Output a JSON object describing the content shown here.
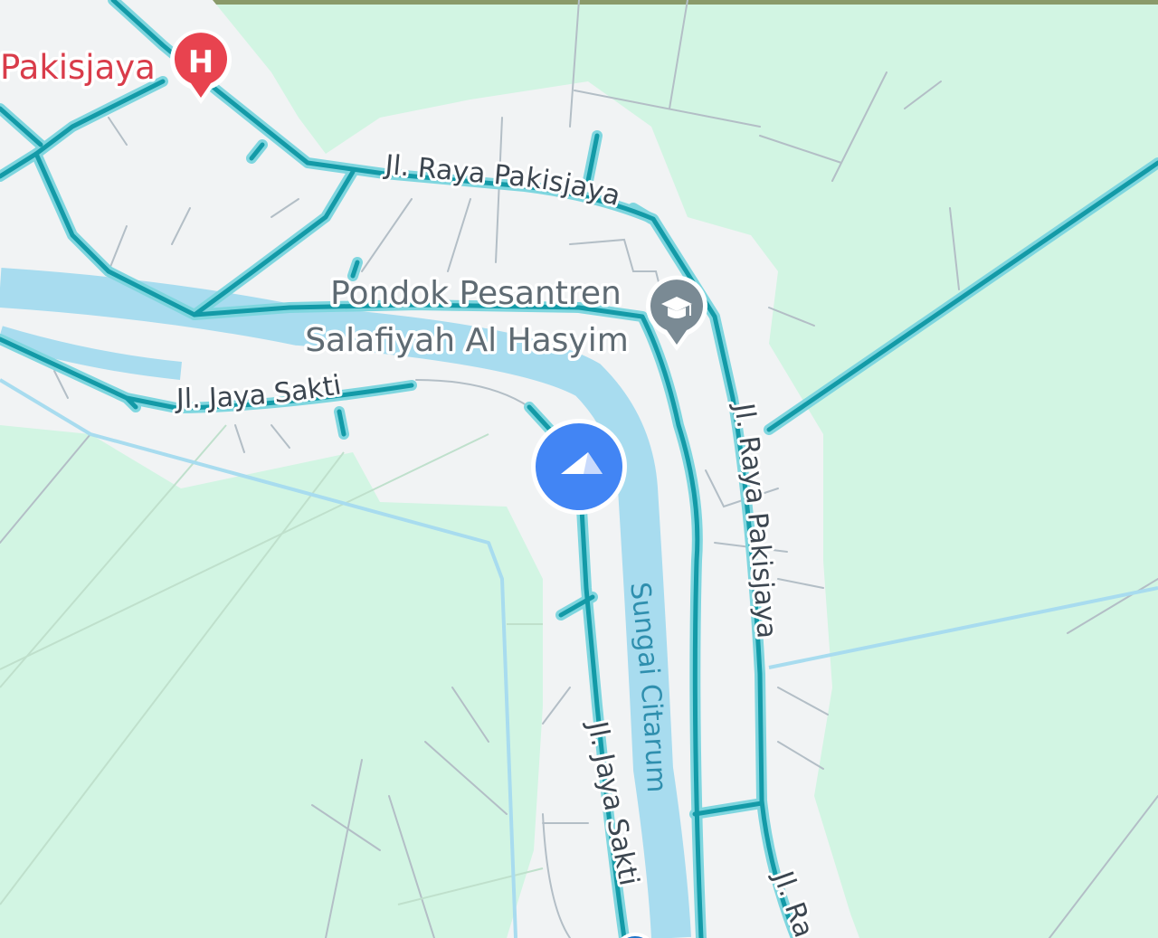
{
  "map": {
    "colors": {
      "land": "#d2f5e3",
      "settlement": "#f1f3f4",
      "water": "#a8dcef",
      "water_label": "#2f8fae",
      "road_fill": "#139aa7",
      "road_casing": "#7fd6df",
      "minor_road": "#b3bec6",
      "hospital_marker": "#e8434f",
      "school_marker": "#7a8a94",
      "location_dot": "#4285f4"
    },
    "labels": {
      "place_pakisjaya": "Pakisjaya",
      "road_raya_pakisjaya_north": "Jl. Raya Pakisjaya",
      "road_raya_pakisjaya_east": "Jl. Raya Pakisjaya",
      "road_raya_pakisjaya_south": "Jl. Ra",
      "road_jaya_sakti_west": "Jl. Jaya Sakti",
      "road_jaya_sakti_south": "Jl. Jaya Sakti",
      "poi_line1": "Pondok Pesantren",
      "poi_line2": "Salafiyah Al Hasyim",
      "river": "Sungai Citarum"
    },
    "markers": {
      "hospital_glyph": "H",
      "hospital_icon": "hospital-pin-icon",
      "school_icon": "graduation-cap-icon",
      "location_icon": "navigation-arrow-icon"
    }
  }
}
